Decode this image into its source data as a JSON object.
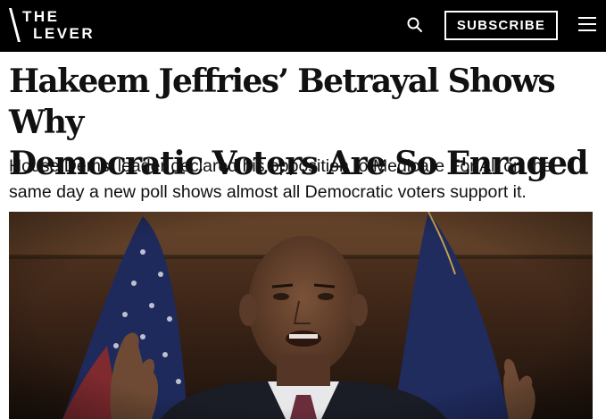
{
  "header": {
    "logo": {
      "line1": "THE",
      "line2": "LEVER"
    },
    "search_icon": "search-icon",
    "subscribe_label": "SUBSCRIBE",
    "menu_icon": "hamburger-menu-icon",
    "background": "#000000"
  },
  "article": {
    "headline_line1": "Hakeem Jeffries’ Betrayal Shows Why",
    "headline_line2": "Democratic Voters Are So Enraged",
    "dek_line1": "House Dems’ leader declared his opposition to Medicare For All on the",
    "dek_line2": "same day a new poll shows almost all Democratic voters support it."
  }
}
